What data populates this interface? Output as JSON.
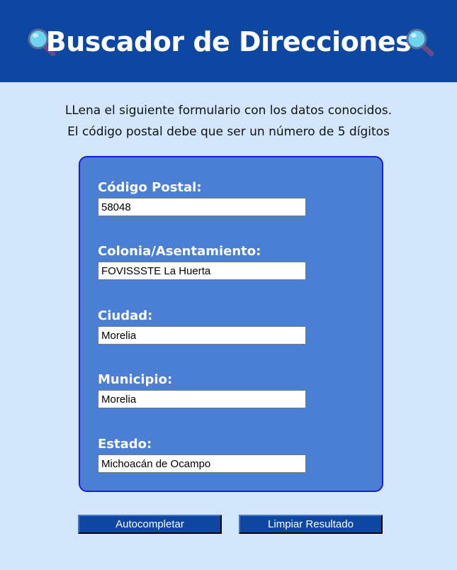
{
  "header": {
    "title": "Buscador de Direcciones",
    "icon_left": "magnifying-glass-icon",
    "icon_right": "magnifying-glass-icon",
    "background_color": "#0d47a1"
  },
  "intro": {
    "line1": "LLena el siguiente formulario con los datos conocidos.",
    "line2": "El código postal debe que ser un número de 5 dígitos"
  },
  "form": {
    "background_color": "#4a7fd4",
    "fields": {
      "codigo_postal": {
        "label": "Código Postal:",
        "value": "58048"
      },
      "colonia": {
        "label": "Colonia/Asentamiento:",
        "value": "FOVISSSTE La Huerta"
      },
      "ciudad": {
        "label": "Ciudad:",
        "value": "Morelia"
      },
      "municipio": {
        "label": "Municipio:",
        "value": "Morelia"
      },
      "estado": {
        "label": "Estado:",
        "value": "Michoacán de Ocampo"
      }
    }
  },
  "actions": {
    "autocomplete_label": "Autocompletar",
    "clear_label": "Limpiar Resultado"
  },
  "colors": {
    "page_background": "#d3e6fb",
    "button_background": "#0d47a1"
  }
}
